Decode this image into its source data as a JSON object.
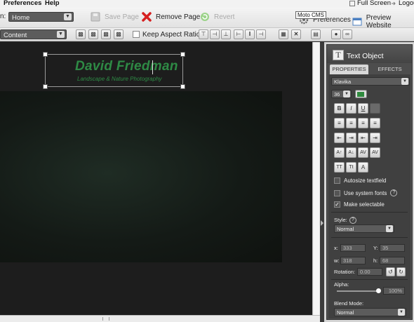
{
  "menubar": {
    "items": [
      "Preferences",
      "Help"
    ],
    "full_screen": "Full Screen",
    "logout": "Logout"
  },
  "page_toolbar": {
    "page_label": "n:",
    "page_select": "Home",
    "save_page": "Save Page",
    "remove_page": "Remove Page",
    "revert": "Revert",
    "preferences": "Preferences",
    "preview_website": "Preview Website",
    "tooltip": "Moto CMS"
  },
  "object_toolbar": {
    "layer_select": "Content",
    "keep_aspect_ratio": "Keep Aspect Ratio"
  },
  "canvas": {
    "site_title": "David Friedman",
    "site_subtitle": "Landscape & Nature Photography"
  },
  "panel": {
    "title": "Text Object",
    "tabs": [
      "PROPERTIES",
      "EFFECTS"
    ],
    "font": "Klavika",
    "size": "36",
    "color": "#2f8a3e",
    "format_buttons": [
      "B",
      "I",
      "U"
    ],
    "autosize": "Autosize textfield",
    "system_fonts": "Use system fonts",
    "selectable": "Make selectable",
    "style_label": "Style:",
    "style_value": "Normal",
    "x_label": "x:",
    "x_value": "333",
    "y_label": "Y:",
    "y_value": "35",
    "w_label": "w:",
    "w_value": "318",
    "h_label": "h:",
    "h_value": "68",
    "rotation_label": "Rotation:",
    "rotation_value": "0.00",
    "alpha_label": "Alpha:",
    "alpha_value": "100%",
    "alpha_level": 1.0,
    "blend_label": "Blend Mode:",
    "blend_value": "Normal",
    "make_selectable_checked": true
  }
}
